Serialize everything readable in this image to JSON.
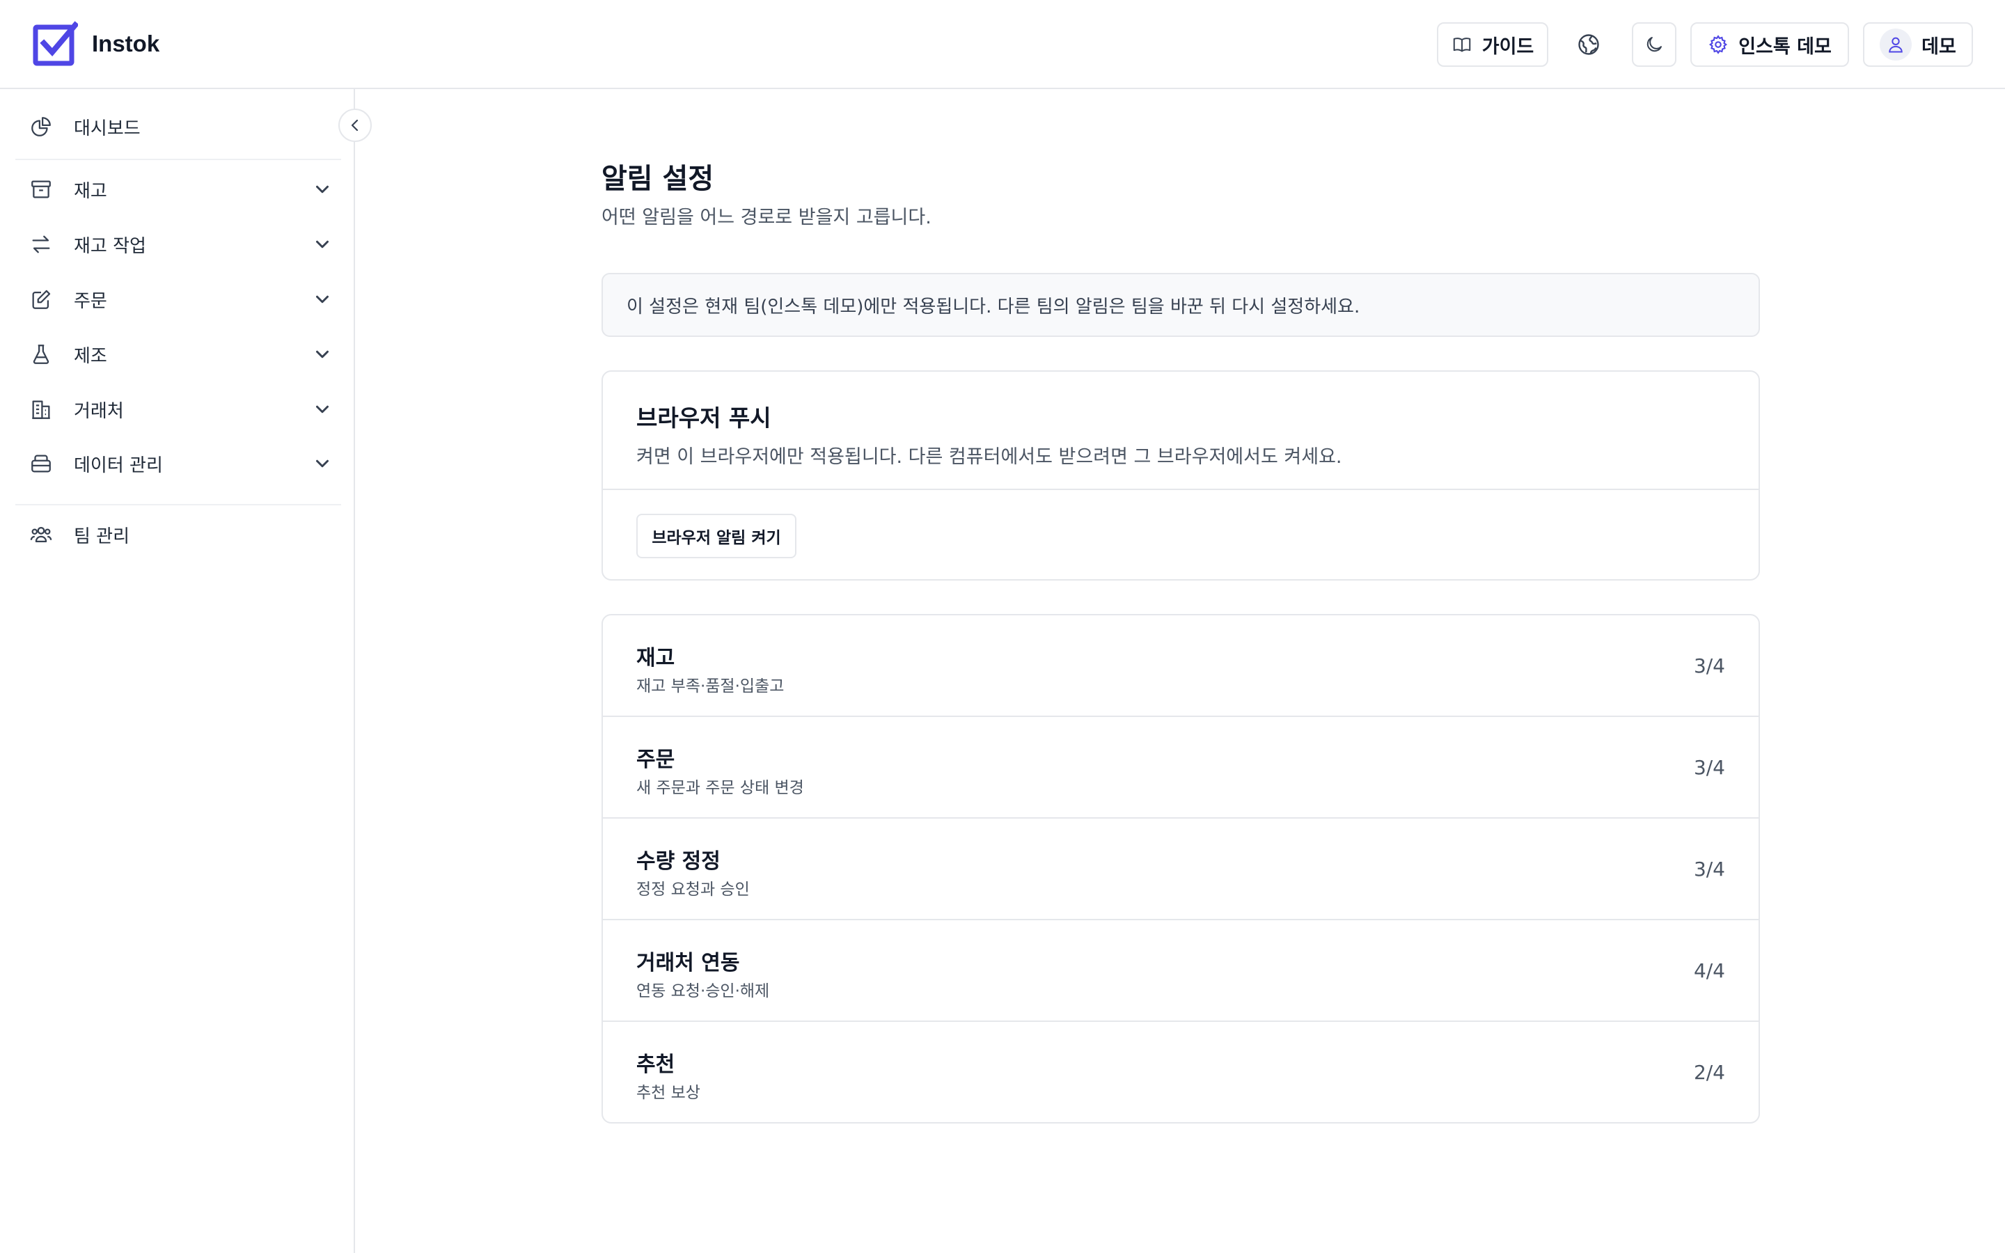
{
  "app": {
    "name": "Instok"
  },
  "header": {
    "guide_label": "가이드",
    "team_label": "인스톡 데모",
    "user_label": "데모",
    "icons": {
      "guide": "book-icon",
      "language": "globe-icon",
      "theme": "moon-icon",
      "team": "gear-icon",
      "user": "user-icon"
    }
  },
  "sidebar": {
    "items": [
      {
        "label": "대시보드",
        "icon": "pie-chart-icon",
        "expandable": false
      },
      {
        "label": "재고",
        "icon": "archive-box-icon",
        "expandable": true
      },
      {
        "label": "재고 작업",
        "icon": "arrows-swap-icon",
        "expandable": true
      },
      {
        "label": "주문",
        "icon": "edit-document-icon",
        "expandable": true
      },
      {
        "label": "제조",
        "icon": "flask-icon",
        "expandable": true
      },
      {
        "label": "거래처",
        "icon": "building-icon",
        "expandable": true
      },
      {
        "label": "데이터 관리",
        "icon": "database-icon",
        "expandable": true
      },
      {
        "label": "팀 관리",
        "icon": "users-icon",
        "expandable": false
      }
    ]
  },
  "main": {
    "title": "알림 설정",
    "subtitle": "어떤 알림을 어느 경로로 받을지 고릅니다.",
    "notice": "이 설정은 현재 팀(인스톡 데모)에만 적용됩니다. 다른 팀의 알림은 팀을 바꾼 뒤 다시 설정하세요.",
    "push": {
      "title": "브라우저 푸시",
      "description": "켜면 이 브라우저에만 적용됩니다. 다른 컴퓨터에서도 받으려면 그 브라우저에서도 켜세요.",
      "button_label": "브라우저 알림 켜기"
    },
    "categories": [
      {
        "title": "재고",
        "description": "재고 부족·품절·입출고",
        "count": "3/4"
      },
      {
        "title": "주문",
        "description": "새 주문과 주문 상태 변경",
        "count": "3/4"
      },
      {
        "title": "수량 정정",
        "description": "정정 요청과 승인",
        "count": "3/4"
      },
      {
        "title": "거래처 연동",
        "description": "연동 요청·승인·해제",
        "count": "4/4"
      },
      {
        "title": "추천",
        "description": "추천 보상",
        "count": "2/4"
      }
    ]
  },
  "colors": {
    "brand": "#4f46e5",
    "border": "#e5e7eb",
    "text": "#111827",
    "muted": "#4b5563"
  }
}
